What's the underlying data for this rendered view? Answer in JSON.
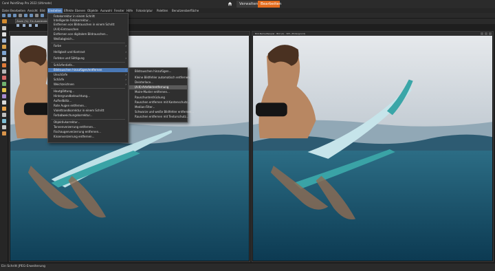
{
  "titlebar": {
    "app_title": "Corel PaintShop Pro 2022 (Ultimate)",
    "workspace_tabs": [
      {
        "label": "Verwalten"
      },
      {
        "label": "Bearbeiten"
      }
    ],
    "accent_color": "#e26b1d"
  },
  "menubar": {
    "items": [
      {
        "label": "Datei"
      },
      {
        "label": "Bearbeiten"
      },
      {
        "label": "Ansicht"
      },
      {
        "label": "Bild"
      },
      {
        "label": "Einstellen"
      },
      {
        "label": "Effekte"
      },
      {
        "label": "Ebenen"
      },
      {
        "label": "Objekte"
      },
      {
        "label": "Auswahl"
      },
      {
        "label": "Fenster"
      },
      {
        "label": "Hilfe"
      },
      {
        "label": "Fotoskriptur"
      },
      {
        "label": "Paletten"
      },
      {
        "label": "Benutzeroberfläche"
      }
    ]
  },
  "tool_options": {
    "zoom_label": "Zoom (%): Ein Ausblenden"
  },
  "documents": {
    "left_title": "",
    "right_title": "Bild-Name-Beispiel - Bild (2) - 30% (Hintergrund)"
  },
  "adjust_menu": {
    "items": [
      {
        "label": "Fotokorrektur in einem Schritt"
      },
      {
        "label": "Intelligente Fotokorrektur..."
      },
      {
        "label": "Entfernen von Bildrauschen in einem Schritt"
      },
      {
        "label": "(A.K)-Entrauschen"
      },
      {
        "label": "Entfernen von digitalem Bildrauschen..."
      },
      {
        "label": "Weißabgleich..."
      },
      {
        "label": "Farbe"
      },
      {
        "label": "Helligkeit und Kontrast"
      },
      {
        "label": "Farbton und Sättigung"
      },
      {
        "label": "Schärfentiefe..."
      },
      {
        "label": "Bildrauschen hinzufügen/entfernen"
      },
      {
        "label": "Unschärfe"
      },
      {
        "label": "Schärfe"
      },
      {
        "label": "Weichzeichnen"
      },
      {
        "label": "Hautglättung..."
      },
      {
        "label": "Hintergrundbeleuchtung..."
      },
      {
        "label": "Aufhellblitz..."
      },
      {
        "label": "Rote Augen entfernen..."
      },
      {
        "label": "Violettrandkorrektur in einem Schritt"
      },
      {
        "label": "Farbabweichungskorrektur..."
      },
      {
        "label": "Objektivkorrektur..."
      },
      {
        "label": "Tonnenverzerrung entfernen..."
      },
      {
        "label": "Fischaugenverzerrung entfernen..."
      },
      {
        "label": "Kissenverzerrung entfernen..."
      }
    ]
  },
  "noise_submenu": {
    "items": [
      {
        "label": "Bildrauschen hinzufügen..."
      },
      {
        "label": "Kleine Bildfehler automatisch entfernen..."
      },
      {
        "label": "Deinterlace..."
      },
      {
        "label": "(A.K)-Artefaktentfernung"
      },
      {
        "label": "Moire-Muster entfernen..."
      },
      {
        "label": "Rauschunterdrückung"
      },
      {
        "label": "Rauschen entfernen mit Kantenschutz..."
      },
      {
        "label": "Median-Filter..."
      },
      {
        "label": "Schwarze und weiße Bildfehler entfernen..."
      },
      {
        "label": "Rauschen entfernen mit Texturschutz..."
      }
    ]
  },
  "statusbar": {
    "text": "Ein Schritt JPEG-Erweiterung"
  }
}
